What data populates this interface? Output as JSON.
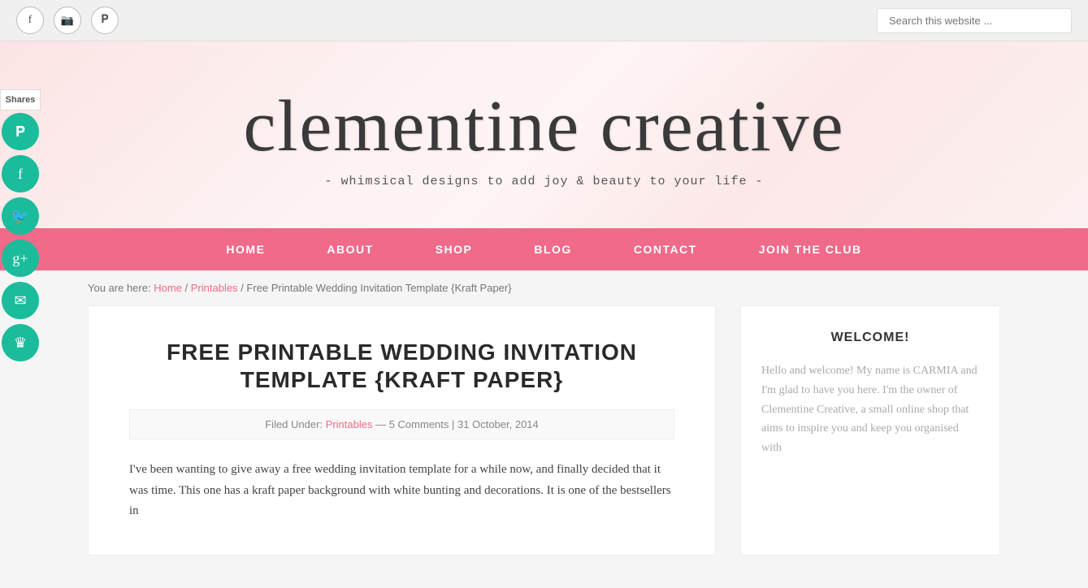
{
  "topbar": {
    "social": {
      "facebook_label": "f",
      "instagram_label": "ig",
      "pinterest_label": "p"
    },
    "search": {
      "placeholder": "Search this website ..."
    }
  },
  "header": {
    "site_title": "clementine creative",
    "site_tagline": "- whimsical designs to add joy & beauty to your life -"
  },
  "nav": {
    "items": [
      {
        "label": "HOME",
        "id": "home"
      },
      {
        "label": "ABOUT",
        "id": "about"
      },
      {
        "label": "SHOP",
        "id": "shop"
      },
      {
        "label": "BLOG",
        "id": "blog"
      },
      {
        "label": "CONTACT",
        "id": "contact"
      },
      {
        "label": "JOIN THE CLUB",
        "id": "join"
      }
    ]
  },
  "breadcrumb": {
    "prefix": "You are here: ",
    "home": "Home",
    "separator1": " / ",
    "printables": "Printables",
    "separator2": " / ",
    "current": "Free Printable Wedding Invitation Template {Kraft Paper}"
  },
  "article": {
    "title": "FREE PRINTABLE WEDDING INVITATION TEMPLATE {KRAFT PAPER}",
    "filed_under_label": "Filed Under: ",
    "filed_under_link": "Printables",
    "comments": "— 5 Comments",
    "date": "| 31 October, 2014",
    "body_text": "I've been wanting to give away a free wedding invitation template for a while now, and finally decided that it was time. This one has a kraft paper background with white bunting and decorations. It is one of the bestsellers in"
  },
  "sidebar": {
    "title": "WELCOME!",
    "text": "Hello and welcome! My name is CARMIA and I'm glad to have you here. I'm the owner of Clementine Creative, a small online shop that aims to inspire you and keep you organised with"
  },
  "social_sidebar": {
    "shares_label": "Shares",
    "pinterest_icon": "P",
    "facebook_icon": "f",
    "twitter_icon": "t",
    "googleplus_icon": "g+",
    "email_icon": "✉",
    "crown_icon": "♛"
  }
}
